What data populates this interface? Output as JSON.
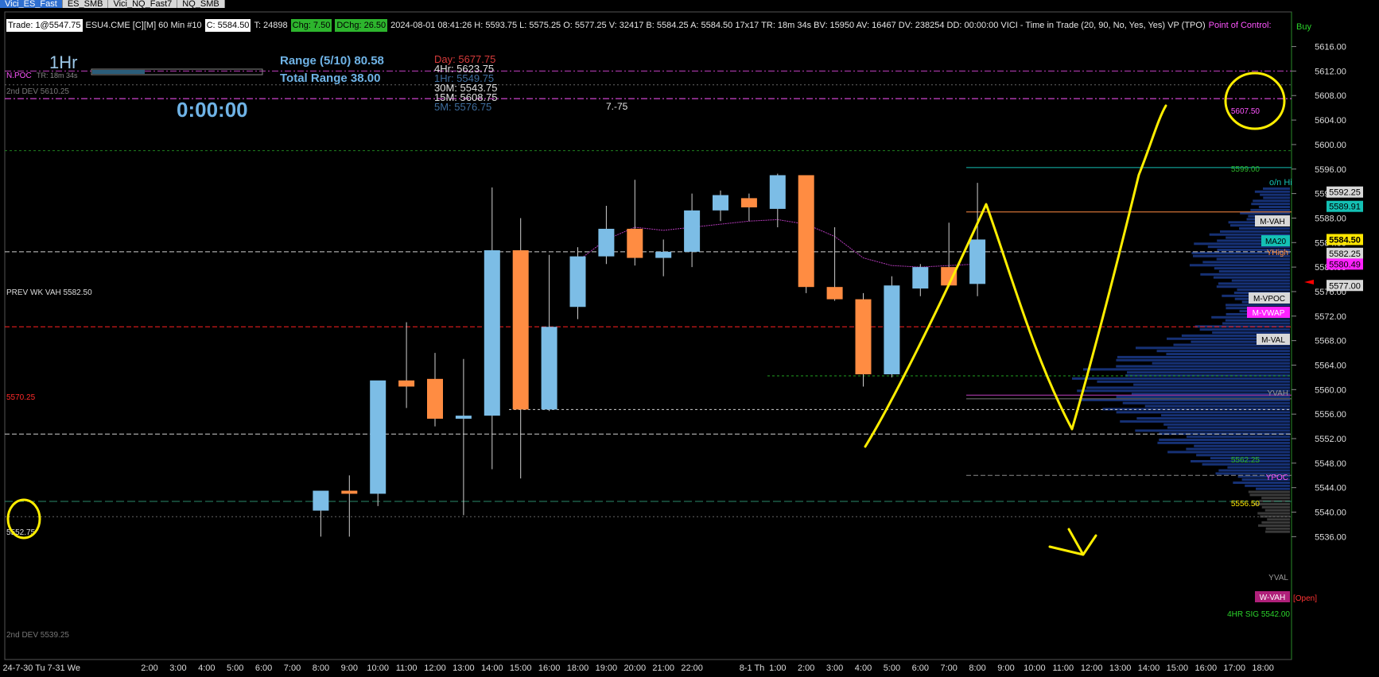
{
  "tabs": [
    {
      "label": "Vici_ES_Fast",
      "active": true
    },
    {
      "label": "ES_SMB",
      "active": false
    },
    {
      "label": "Vici_NQ_Fast7",
      "active": false
    },
    {
      "label": "NQ_SMB",
      "active": false
    }
  ],
  "status": {
    "trade": "Trade: 1@5547.75",
    "instrument": "ESU4.CME [C][M]  60 Min  #10",
    "close": "C: 5584.50",
    "t": "T: 24898",
    "chg": "Chg: 7.50",
    "dchg": "DChg: 26.50",
    "info": "2024-08-01 08:41:26 H: 5593.75 L: 5575.25 O: 5577.25 V: 32417 B: 5584.25 A: 5584.50 17x17 TR: 18m 34s BV: 15950 AV: 16467 DV: 238254 DD: 00:00:00 VICI - Time in Trade  (20, 90, No, Yes, Yes)  VP (TPO)",
    "poc": "Point of Control:",
    "buy": "Buy"
  },
  "panel": {
    "timeframe": "1Hr",
    "npoc": "N.POC",
    "tr": "TR: 18m 34s",
    "timer": "0:00:00",
    "range": "Range (5/10) 80.58",
    "total_range": "Total Range 38.00",
    "levels": [
      {
        "label": "Day:  5677.75",
        "color": "#d63a3a"
      },
      {
        "label": "4Hr:  5623.75",
        "color": "#e0e0e0"
      },
      {
        "label": "1Hr:  5549.75",
        "color": "#3e6d9e"
      },
      {
        "label": "30M:  5543.75",
        "color": "#e0e0e0"
      },
      {
        "label": "15M:  5608.75",
        "color": "#e0e0e0"
      },
      {
        "label": "5M:   5576.75",
        "color": "#3e6d9e"
      }
    ],
    "note": "7.-75"
  },
  "left_labels": {
    "dev_top": "2nd DEV  5610.25",
    "prev_wk_vah": "PREV WK VAH  5582.50",
    "red_level": "5570.25",
    "circled": "5552.75",
    "dev_bottom": "2nd DEV  5539.25"
  },
  "right_labels": {
    "l5607": "5607.50",
    "l5599": "5599.00",
    "onhi": "o/n Hi",
    "mvah": "M-VAH",
    "ma20": "MA20",
    "yhigh": "YHigh",
    "mvpoc": "M-VPOC",
    "mvwap": "M-VWAP",
    "mval": "M-VAL",
    "yvah": "YVAH",
    "l5562": "5562.25",
    "ypoc": "YPOC",
    "l5556": "5556.50",
    "yval": "YVAL",
    "wvah": "W-VAH",
    "open": "[Open]",
    "sig": "4HR SIG  5542.00"
  },
  "price_axis": {
    "ticks": [
      "5616.00",
      "5612.00",
      "5608.00",
      "5604.00",
      "5600.00",
      "5596.00",
      "5592.00",
      "5588.00",
      "5584.00",
      "5580.00",
      "5576.00",
      "5572.00",
      "5568.00",
      "5564.00",
      "5560.00",
      "5556.00",
      "5552.00",
      "5548.00",
      "5544.00",
      "5540.00",
      "5536.00"
    ],
    "tags": [
      {
        "text": "5592.25",
        "bg": "#d8d8d8",
        "fg": "#000"
      },
      {
        "text": "5589.91",
        "bg": "#14c0b4",
        "fg": "#000"
      },
      {
        "text": "5584.50",
        "bg": "#ffe600",
        "fg": "#000"
      },
      {
        "text": "5582.25",
        "bg": "#d8d8d8",
        "fg": "#000"
      },
      {
        "text": "5580.49",
        "bg": "#ff22ff",
        "fg": "#000"
      },
      {
        "text": "5577.00",
        "bg": "#d8d8d8",
        "fg": "#000"
      }
    ]
  },
  "time_axis": {
    "labels": [
      {
        "text": "24-7-30 Tu",
        "slot": -4.4
      },
      {
        "text": "7-31 We",
        "slot": -3.0
      },
      {
        "text": "2:00",
        "slot": 0
      },
      {
        "text": "3:00",
        "slot": 1
      },
      {
        "text": "4:00",
        "slot": 2
      },
      {
        "text": "5:00",
        "slot": 3
      },
      {
        "text": "6:00",
        "slot": 4
      },
      {
        "text": "7:00",
        "slot": 5
      },
      {
        "text": "8:00",
        "slot": 6
      },
      {
        "text": "9:00",
        "slot": 7
      },
      {
        "text": "10:00",
        "slot": 8
      },
      {
        "text": "11:00",
        "slot": 9
      },
      {
        "text": "12:00",
        "slot": 10
      },
      {
        "text": "13:00",
        "slot": 11
      },
      {
        "text": "14:00",
        "slot": 12
      },
      {
        "text": "15:00",
        "slot": 13
      },
      {
        "text": "16:00",
        "slot": 14
      },
      {
        "text": "18:00",
        "slot": 15
      },
      {
        "text": "19:00",
        "slot": 16
      },
      {
        "text": "20:00",
        "slot": 17
      },
      {
        "text": "21:00",
        "slot": 18
      },
      {
        "text": "22:00",
        "slot": 19
      },
      {
        "text": "8-1 Th",
        "slot": 21.1
      },
      {
        "text": "1:00",
        "slot": 22
      },
      {
        "text": "2:00",
        "slot": 23
      },
      {
        "text": "3:00",
        "slot": 24
      },
      {
        "text": "4:00",
        "slot": 25
      },
      {
        "text": "5:00",
        "slot": 26
      },
      {
        "text": "6:00",
        "slot": 27
      },
      {
        "text": "7:00",
        "slot": 28
      },
      {
        "text": "8:00",
        "slot": 29
      },
      {
        "text": "9:00",
        "slot": 30
      },
      {
        "text": "10:00",
        "slot": 31
      },
      {
        "text": "11:00",
        "slot": 32
      },
      {
        "text": "12:00",
        "slot": 33
      },
      {
        "text": "13:00",
        "slot": 34
      },
      {
        "text": "14:00",
        "slot": 35
      },
      {
        "text": "15:00",
        "slot": 36
      },
      {
        "text": "16:00",
        "slot": 37
      },
      {
        "text": "17:00",
        "slot": 38
      },
      {
        "text": "18:00",
        "slot": 39
      }
    ]
  },
  "colors": {
    "up": "#7cbde6",
    "down": "#ff8c42",
    "wick": "#cfcfcf",
    "vwap": "#b23ab8",
    "annotation": "#ffee00",
    "profile": "#1a3a8a"
  },
  "chart_data": {
    "type": "candlestick",
    "interval": "60 Min",
    "ylim": [
      5535,
      5618
    ],
    "candles": [
      {
        "time": "7-31 8:00",
        "o": 5540.25,
        "h": 5542.0,
        "l": 5536.0,
        "c": 5543.5
      },
      {
        "time": "7-31 9:00",
        "o": 5543.5,
        "h": 5546.0,
        "l": 5536.0,
        "c": 5543.0
      },
      {
        "time": "7-31 10:00",
        "o": 5543.0,
        "h": 5558.0,
        "l": 5541.0,
        "c": 5561.5
      },
      {
        "time": "7-31 11:00",
        "o": 5561.5,
        "h": 5571.0,
        "l": 5557.0,
        "c": 5560.5
      },
      {
        "time": "7-31 12:00",
        "o": 5561.75,
        "h": 5566.0,
        "l": 5554.0,
        "c": 5555.25
      },
      {
        "time": "7-31 13:00",
        "o": 5555.25,
        "h": 5565.0,
        "l": 5539.5,
        "c": 5555.75
      },
      {
        "time": "7-31 14:00",
        "o": 5555.75,
        "h": 5593.0,
        "l": 5547.0,
        "c": 5582.75
      },
      {
        "time": "7-31 15:00",
        "o": 5582.75,
        "h": 5588.0,
        "l": 5545.5,
        "c": 5556.75
      },
      {
        "time": "7-31 16:00",
        "o": 5556.75,
        "h": 5582.0,
        "l": 5556.5,
        "c": 5570.25
      },
      {
        "time": "7-31 18:00",
        "o": 5573.5,
        "h": 5583.25,
        "l": 5571.5,
        "c": 5581.75
      },
      {
        "time": "7-31 19:00",
        "o": 5581.75,
        "h": 5590.0,
        "l": 5580.5,
        "c": 5586.25
      },
      {
        "time": "7-31 20:00",
        "o": 5586.25,
        "h": 5594.25,
        "l": 5580.25,
        "c": 5581.5
      },
      {
        "time": "7-31 21:00",
        "o": 5581.5,
        "h": 5584.5,
        "l": 5578.5,
        "c": 5582.5
      },
      {
        "time": "7-31 22:00",
        "o": 5582.5,
        "h": 5592.0,
        "l": 5580.0,
        "c": 5589.25
      },
      {
        "time": "7-31 23:00",
        "o": 5589.25,
        "h": 5592.5,
        "l": 5587.5,
        "c": 5591.75
      },
      {
        "time": "8-1 0:00",
        "o": 5591.25,
        "h": 5592.0,
        "l": 5587.5,
        "c": 5589.75
      },
      {
        "time": "8-1 1:00",
        "o": 5589.5,
        "h": 5595.25,
        "l": 5586.5,
        "c": 5595.0
      },
      {
        "time": "8-1 2:00",
        "o": 5595.0,
        "h": 5594.75,
        "l": 5575.75,
        "c": 5576.75
      },
      {
        "time": "8-1 3:00",
        "o": 5576.75,
        "h": 5586.5,
        "l": 5574.5,
        "c": 5574.75
      },
      {
        "time": "8-1 4:00",
        "o": 5574.75,
        "h": 5575.75,
        "l": 5560.5,
        "c": 5562.5
      },
      {
        "time": "8-1 5:00",
        "o": 5562.5,
        "h": 5578.5,
        "l": 5562.0,
        "c": 5577.0
      },
      {
        "time": "8-1 6:00",
        "o": 5576.5,
        "h": 5580.5,
        "l": 5575.25,
        "c": 5580.0
      },
      {
        "time": "8-1 7:00",
        "o": 5580.0,
        "h": 5587.25,
        "l": 5576.75,
        "c": 5577.0
      },
      {
        "time": "8-1 8:00",
        "o": 5577.25,
        "h": 5593.75,
        "l": 5575.25,
        "c": 5584.5
      }
    ],
    "vwap": [
      {
        "time": "7-31 18:00",
        "value": 5581.0
      },
      {
        "time": "7-31 19:00",
        "value": 5584.5
      },
      {
        "time": "7-31 20:00",
        "value": 5586.5
      },
      {
        "time": "7-31 21:00",
        "value": 5586.0
      },
      {
        "time": "7-31 22:00",
        "value": 5586.5
      },
      {
        "time": "7-31 23:00",
        "value": 5587.0
      },
      {
        "time": "8-1 0:00",
        "value": 5587.5
      },
      {
        "time": "8-1 1:00",
        "value": 5587.75
      },
      {
        "time": "8-1 2:00",
        "value": 5587.0
      },
      {
        "time": "8-1 3:00",
        "value": 5585.0
      },
      {
        "time": "8-1 4:00",
        "value": 5581.5
      },
      {
        "time": "8-1 5:00",
        "value": 5580.25
      },
      {
        "time": "8-1 6:00",
        "value": 5580.0
      },
      {
        "time": "8-1 7:00",
        "value": 5580.25
      },
      {
        "time": "8-1 8:00",
        "value": 5580.5
      }
    ]
  }
}
